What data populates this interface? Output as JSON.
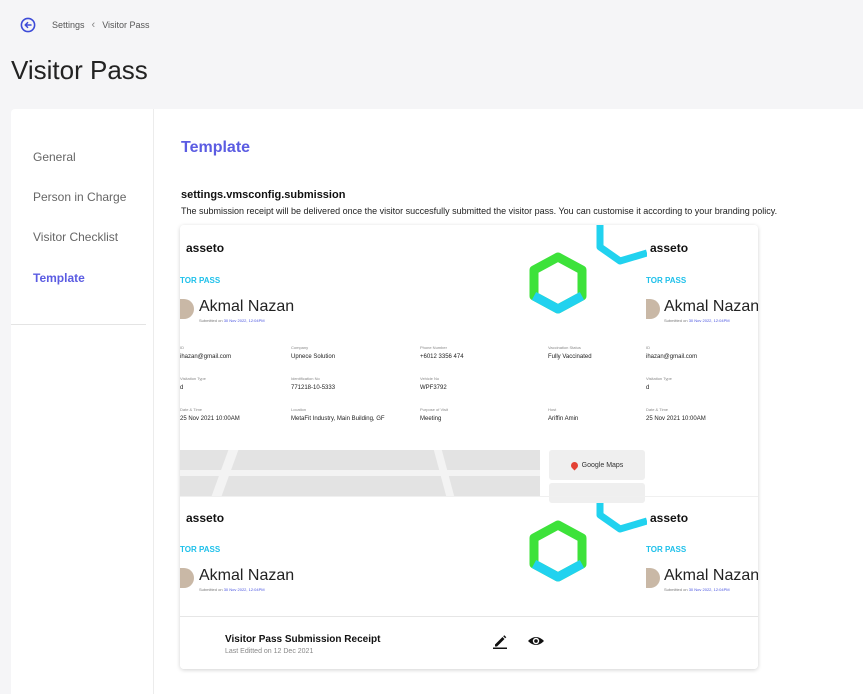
{
  "breadcrumb": {
    "items": [
      "Settings",
      "Visitor Pass"
    ]
  },
  "page": {
    "title": "Visitor Pass"
  },
  "sidebar": {
    "items": [
      {
        "label": "General",
        "active": false
      },
      {
        "label": "Person in Charge",
        "active": false
      },
      {
        "label": "Visitor Checklist",
        "active": false
      },
      {
        "label": "Template",
        "active": true
      }
    ]
  },
  "content": {
    "section_title": "Template",
    "subheading": "settings.vmsconfig.submission",
    "description": "The submission receipt will be delivered once the visitor succesfully submitted the visitor pass. You can customise it according to your branding policy."
  },
  "template_card": {
    "name": "Visitor Pass Submission Receipt",
    "last_edited": "Last Editted on 12 Dec 2021",
    "preview": {
      "brand": "asseto",
      "pass_label": "TOR PASS",
      "visitor_name": "Akmal Nazan",
      "submitted_prefix": "Submitted on",
      "submitted_date": "30 Nov 2022, 12:04PM",
      "fields": {
        "email_label": "ID",
        "email": "ihazan@gmail.com",
        "company_label": "Company",
        "company": "Upnece Solution",
        "phone_label": "Phone Number",
        "phone": "+6012 3356 474",
        "vaccination_label": "Vaccination Status",
        "vaccination": "Fully Vaccinated",
        "visit_type_label": "Visitation Type",
        "visit_type": "d",
        "id_label": "Identification No",
        "id_no": "771218-10-5333",
        "vehicle_label": "Vehicle No",
        "vehicle": "WPF3792",
        "datetime_label": "Date & Time",
        "datetime": "25 Nov 2021 10:00AM",
        "location_label": "Location",
        "location": "MetaFit Industry, Main Building, GF",
        "purpose_label": "Purpose of Visit",
        "purpose": "Meeting",
        "host_label": "Host",
        "host": "Ariffin Amin"
      },
      "map_button": "Google Maps"
    }
  },
  "colors": {
    "accent": "#5b5ce2",
    "pass_cyan": "#1ec0ea",
    "hex_green": "#3de23a",
    "hex_cyan": "#21d2ef"
  },
  "icons": {
    "back": "back-circle-arrow-icon",
    "edit": "pencil-icon",
    "view": "eye-icon"
  }
}
